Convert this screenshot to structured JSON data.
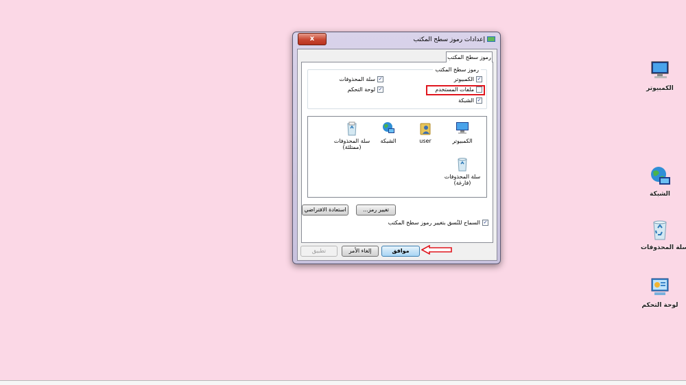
{
  "desktop": {
    "icons": [
      {
        "label": "الكمبيوتر",
        "icon": "computer-icon"
      },
      {
        "label": "الشبكة",
        "icon": "network-icon"
      },
      {
        "label": "سلة المحذوفات",
        "icon": "recycle-bin-icon"
      },
      {
        "label": "لوحة التحكم",
        "icon": "control-panel-icon"
      }
    ]
  },
  "dialog": {
    "title": "إعدادات رموز سطح المكتب",
    "close_label": "x",
    "tab": "رموز سطح المكتب",
    "group_title": "رموز سطح المكتب",
    "checkboxes": [
      {
        "label": "الكمبيوتر",
        "checked": true
      },
      {
        "label": "سلة المحذوفات",
        "checked": true
      },
      {
        "label": "ملفات المستخدم",
        "checked": false
      },
      {
        "label": "لوحة التحكم",
        "checked": true
      },
      {
        "label": "الشبكة",
        "checked": true
      }
    ],
    "icon_list": [
      {
        "label": "الكمبيوتر",
        "icon": "computer-icon"
      },
      {
        "label": "user",
        "icon": "user-folder-icon"
      },
      {
        "label": "الشبكة",
        "icon": "network-icon"
      },
      {
        "label": "سلة المحذوفات (ممتلئة)",
        "icon": "recycle-bin-full-icon"
      },
      {
        "label": "سلة المحذوفات (فارغة)",
        "icon": "recycle-bin-empty-icon"
      }
    ],
    "change_icon_label": "تغيير رمز...",
    "restore_default_label": "استعادة الافتراضي",
    "allow_themes_label": "السماح للنُسق بتغيير رموز سطح المكتب",
    "allow_themes_checked": true,
    "ok_label": "موافق",
    "cancel_label": "إلغاء الأمر",
    "apply_label": "تطبيق"
  },
  "colors": {
    "desktop_background": "#fbd8e6",
    "annotation_red": "#e0151d"
  }
}
